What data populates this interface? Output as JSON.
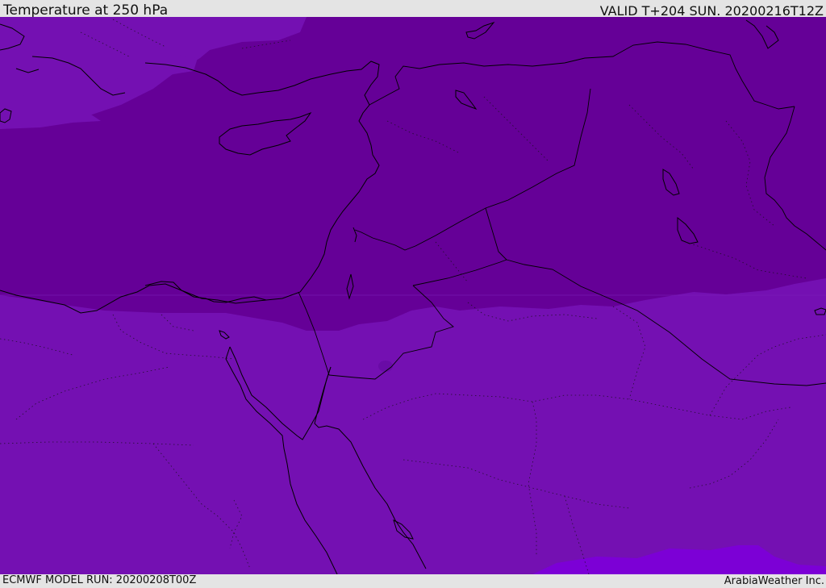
{
  "header": {
    "title": "Temperature at 250 hPa",
    "valid": "VALID T+204 SUN. 20200216T12Z"
  },
  "footer": {
    "model_run": "ECMWF MODEL RUN: 20200208T00Z",
    "credit": "ArabiaWeather Inc."
  },
  "map": {
    "fill_colors": {
      "cold_band": "#650097",
      "mid_band": "#7410b2",
      "warm_band": "#7b14c0",
      "warmest_band": "#7c00d6"
    },
    "coastline_color": "#000000",
    "border_color": "#000000"
  }
}
